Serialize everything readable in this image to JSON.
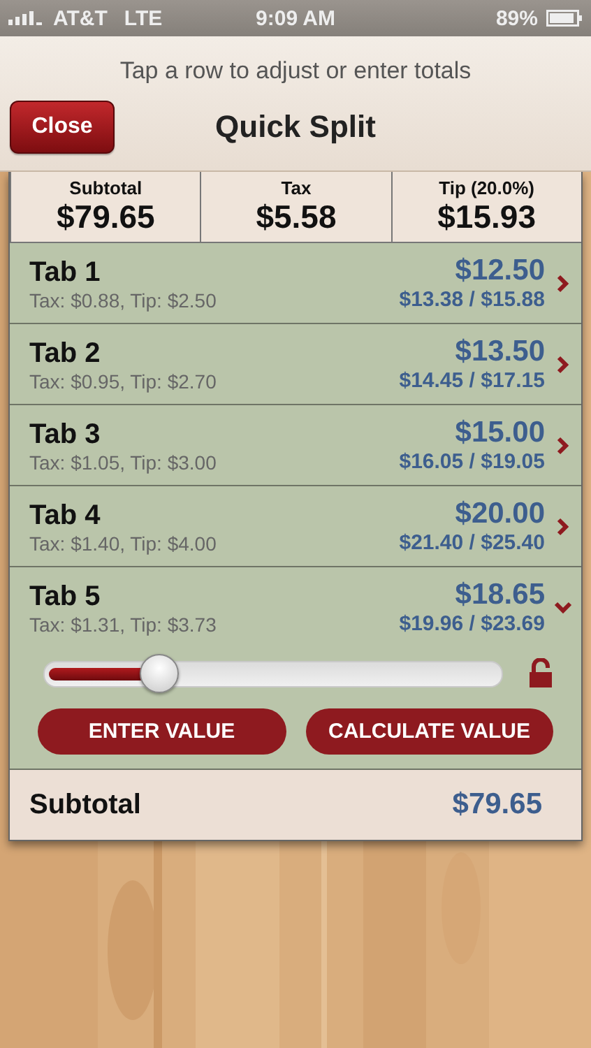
{
  "status_bar": {
    "carrier": "AT&T",
    "network": "LTE",
    "time": "9:09 AM",
    "battery": "89%"
  },
  "header": {
    "hint": "Tap a row to adjust or enter totals",
    "title": "Quick Split",
    "close_button": "Close"
  },
  "summary": [
    {
      "label": "Subtotal",
      "value": "$79.65"
    },
    {
      "label": "Tax",
      "value": "$5.58"
    },
    {
      "label": "Tip (20.0%)",
      "value": "$15.93"
    }
  ],
  "tabs": [
    {
      "name": "Tab 1",
      "detail": "Tax: $0.88, Tip: $2.50",
      "amount": "$12.50",
      "totals": "$13.38 / $15.88",
      "expanded": false
    },
    {
      "name": "Tab 2",
      "detail": "Tax: $0.95, Tip: $2.70",
      "amount": "$13.50",
      "totals": "$14.45 / $17.15",
      "expanded": false
    },
    {
      "name": "Tab 3",
      "detail": "Tax: $1.05, Tip: $3.00",
      "amount": "$15.00",
      "totals": "$16.05 / $19.05",
      "expanded": false
    },
    {
      "name": "Tab 4",
      "detail": "Tax: $1.40, Tip: $4.00",
      "amount": "$20.00",
      "totals": "$21.40 / $25.40",
      "expanded": false
    },
    {
      "name": "Tab 5",
      "detail": "Tax: $1.31, Tip: $3.73",
      "amount": "$18.65",
      "totals": "$19.96 / $23.69",
      "expanded": true,
      "level": 0.25,
      "locked": false,
      "buttons": [
        "ENTER VALUE",
        "CALCULATE VALUE"
      ]
    }
  ],
  "total": {
    "label": "Subtotal",
    "value": "$79.65"
  }
}
